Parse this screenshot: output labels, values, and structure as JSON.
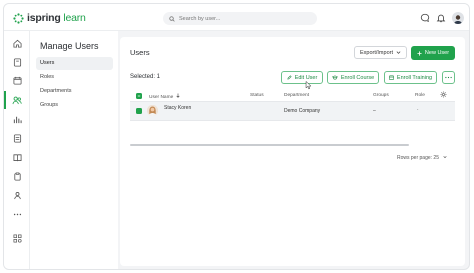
{
  "brand": {
    "name_part1": "ispring",
    "name_part2": " learn",
    "accent": "#20a24c"
  },
  "search": {
    "placeholder": "Search by user..."
  },
  "top_icons": [
    "chat-icon",
    "bell-icon",
    "user-avatar"
  ],
  "rail": {
    "icons": [
      "home-icon",
      "book-icon",
      "calendar-icon",
      "users-icon",
      "chart-icon",
      "report-icon",
      "book-open-icon",
      "clipboard-icon",
      "person-badge-icon",
      "more-icon",
      "apps-icon"
    ],
    "active": "users-icon"
  },
  "sidebar": {
    "title": "Manage Users",
    "items": [
      {
        "label": "Users",
        "active": true
      },
      {
        "label": "Roles",
        "active": false
      },
      {
        "label": "Departments",
        "active": false
      },
      {
        "label": "Groups",
        "active": false
      }
    ]
  },
  "main": {
    "title": "Users",
    "export_label": "Export/Import",
    "new_user_label": "New User",
    "selected_text": "Selected: 1",
    "actions": {
      "edit_user": "Edit User",
      "enroll_course": "Enroll Course",
      "enroll_training": "Enroll Training"
    },
    "columns": {
      "user_name": "User Name",
      "status": "Status",
      "department": "Department",
      "groups": "Groups",
      "role": "Role"
    },
    "rows": [
      {
        "user_name": "Stacy Koren",
        "status": "",
        "department": "Demo Company",
        "groups": "–",
        "role": "·",
        "selected": true
      }
    ],
    "pager": {
      "label": "Rows per page: 25"
    }
  }
}
